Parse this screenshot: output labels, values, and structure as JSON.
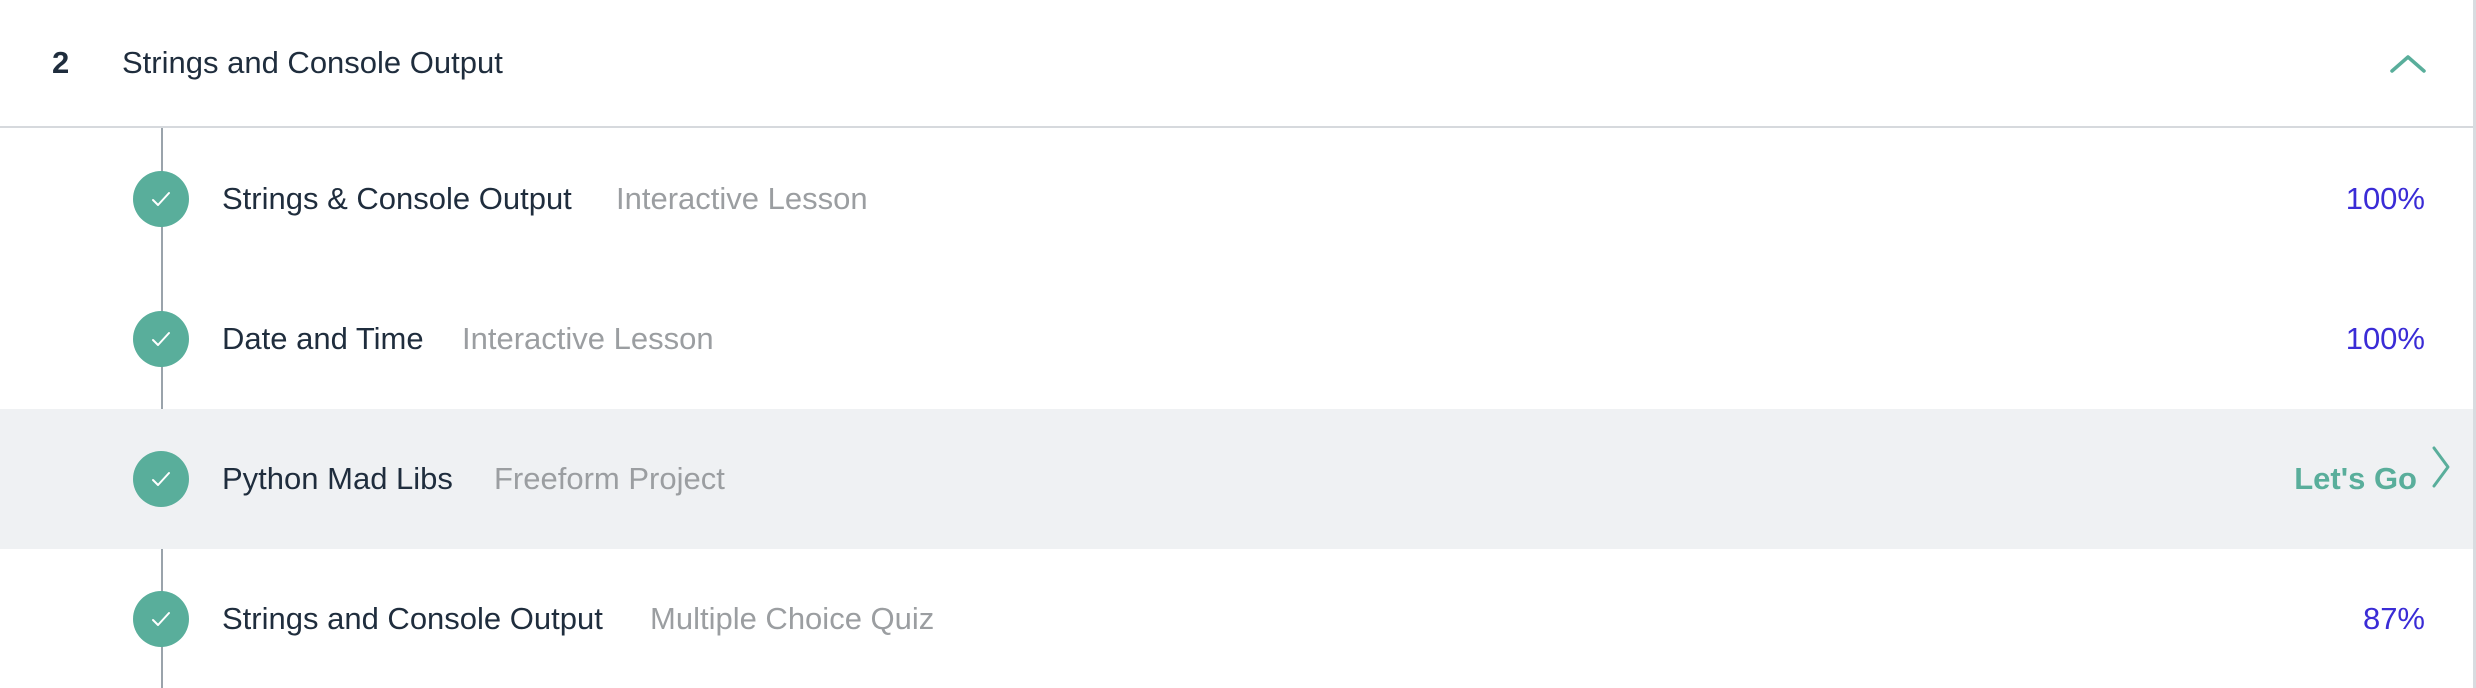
{
  "unit": {
    "number": "2",
    "title": "Strings and Console Output",
    "collapse_icon": "chevron-up-icon"
  },
  "items": [
    {
      "title": "Strings & Console Output",
      "type": "Interactive Lesson",
      "status": "100%",
      "completed": true
    },
    {
      "title": "Date and Time",
      "type": "Interactive Lesson",
      "status": "100%",
      "completed": true
    },
    {
      "title": "Python Mad Libs",
      "type": "Freeform Project",
      "action": "Let's Go",
      "completed": true
    },
    {
      "title": "Strings and Console Output",
      "type": "Multiple Choice Quiz",
      "status": "87%",
      "completed": true
    }
  ],
  "colors": {
    "accent": "#59ae9b",
    "status": "#3a2cd6",
    "muted": "#9b9ea1",
    "text": "#1f2d3d",
    "highlight_row": "#eff1f3"
  }
}
